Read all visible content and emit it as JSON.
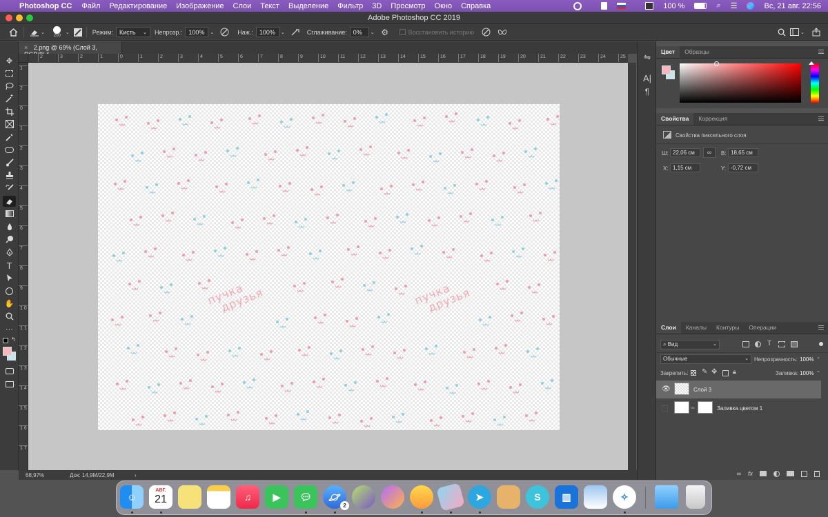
{
  "menubar": {
    "app_name": "Photoshop CC",
    "items": [
      "Файл",
      "Редактирование",
      "Изображение",
      "Слои",
      "Текст",
      "Выделение",
      "Фильтр",
      "3D",
      "Просмотр",
      "Окно",
      "Справка"
    ],
    "battery": "100 %",
    "datetime": "Вс, 21 авг.  22:56"
  },
  "window": {
    "title": "Adobe Photoshop CC 2019"
  },
  "options_bar": {
    "brush_size": "200",
    "mode_label": "Режим:",
    "mode_value": "Кисть",
    "opacity_label": "Непрозр.:",
    "opacity_value": "100%",
    "pressure_label": "Наж.:",
    "pressure_value": "100%",
    "smoothing_label": "Сглаживание:",
    "smoothing_value": "0%",
    "history_label": "Восстановить историю"
  },
  "document": {
    "tab_title": "2.png @ 69% (Слой 3, RGB/8) *",
    "zoom": "68,97%",
    "doc_info": "Док: 14,9M/22,9M",
    "ruler_h": [
      "2",
      "3",
      "2",
      "1",
      "0",
      "1",
      "2",
      "3",
      "4",
      "5",
      "6",
      "7",
      "8",
      "9",
      "10",
      "11",
      "12",
      "13",
      "14",
      "15",
      "16",
      "17",
      "18",
      "19",
      "20",
      "21",
      "22",
      "23",
      "24",
      "25",
      "26"
    ],
    "ruler_v": [
      "1",
      "2",
      "0",
      "1",
      "2",
      "3",
      "4",
      "5",
      "6",
      "7",
      "8",
      "9",
      "1 0",
      "1 1",
      "1 2",
      "1 3",
      "1 4",
      "1 5",
      "1 6",
      "1 7"
    ],
    "canvas_text": [
      "пучка",
      "друзья"
    ]
  },
  "color_panel": {
    "tabs": [
      "Цвет",
      "Образцы"
    ],
    "foreground": "#f4b8bd",
    "background": "#c6e6ef",
    "hue": "#ff0000"
  },
  "properties_panel": {
    "tabs": [
      "Свойства",
      "Коррекция"
    ],
    "subtitle": "Свойства пиксельного слоя",
    "w_label": "Ш:",
    "w_value": "22,06 см",
    "h_label": "В:",
    "h_value": "18,65 см",
    "x_label": "X:",
    "x_value": "1,15 см",
    "y_label": "Y:",
    "y_value": "-0,72 см"
  },
  "layers_panel": {
    "tabs": [
      "Слои",
      "Каналы",
      "Контуры",
      "Операции"
    ],
    "filter_value": "Вид",
    "blend_mode": "Обычные",
    "opacity_label": "Непрозрачность:",
    "opacity_value": "100%",
    "lock_label": "Закрепить:",
    "fill_label": "Заливка:",
    "fill_value": "100%",
    "layers": [
      {
        "name": "Слой 3",
        "visible": true,
        "selected": true
      },
      {
        "name": "Заливка цветом 1",
        "visible": false,
        "selected": false
      }
    ]
  },
  "dock": {
    "calendar_month": "АВГ.",
    "calendar_day": "21",
    "badge": "2",
    "apps": [
      "finder",
      "calendar",
      "stickies",
      "notes",
      "music",
      "facetime",
      "messages",
      "astro",
      "creature",
      "purple-blob",
      "character",
      "eraser-app",
      "telegram",
      "cookie",
      "s-app",
      "trello",
      "preview",
      "safari",
      "folder",
      "trash"
    ]
  }
}
